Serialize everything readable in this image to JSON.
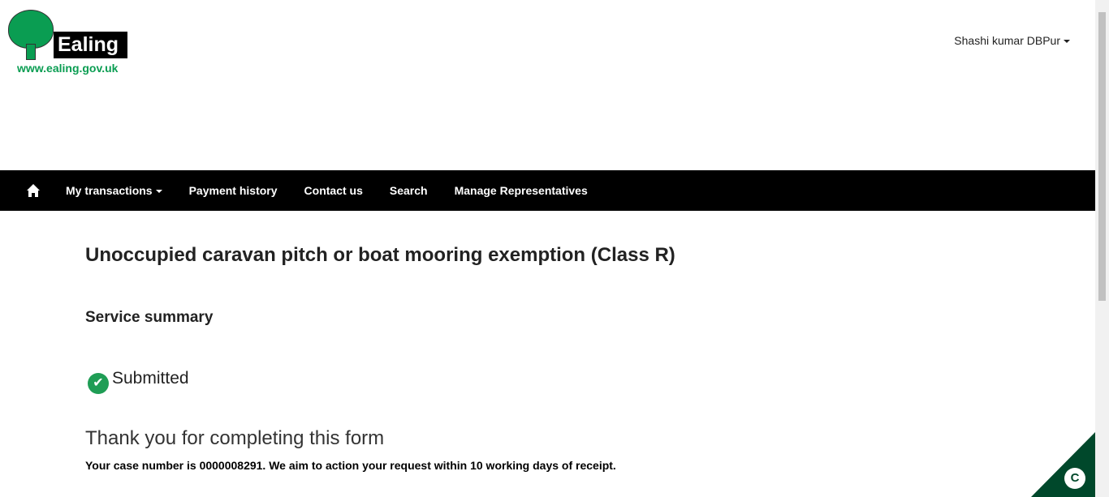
{
  "logo": {
    "name": "Ealing",
    "url": "www.ealing.gov.uk"
  },
  "user": {
    "name": "Shashi kumar DBPur"
  },
  "nav": {
    "items": [
      "My transactions",
      "Payment history",
      "Contact us",
      "Search",
      "Manage Representatives"
    ]
  },
  "main": {
    "title": "Unoccupied caravan pitch or boat mooring exemption (Class R)",
    "subtitle": "Service summary",
    "status": "Submitted",
    "thanks": "Thank you for completing this form",
    "case_text": "Your case number is 0000008291. We aim to action your request within 10 working days of receipt."
  },
  "cookie": {
    "label": "C"
  },
  "colors": {
    "brand": "#0a9d52",
    "nav": "#000000",
    "cookie": "#00482b"
  }
}
